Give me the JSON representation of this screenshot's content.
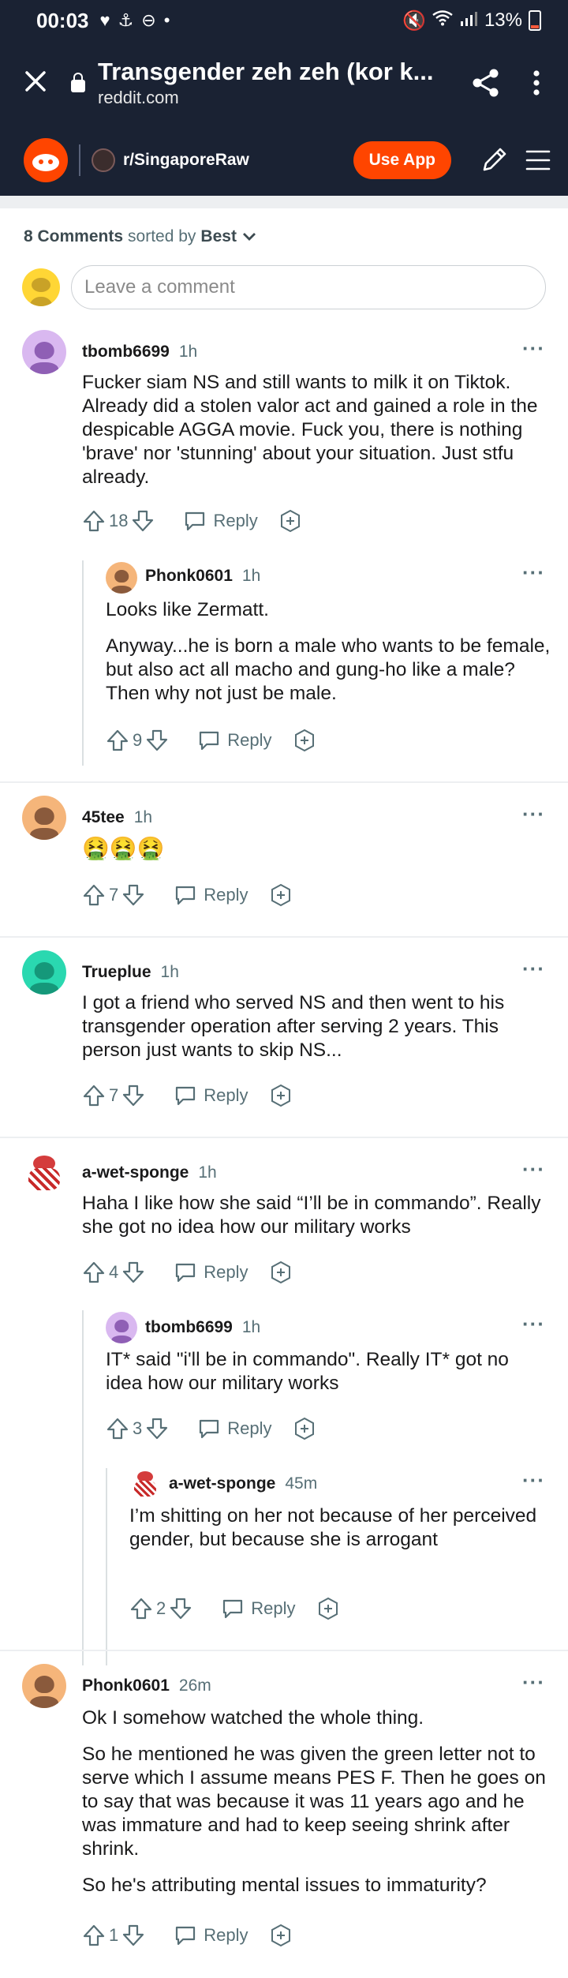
{
  "status_bar": {
    "time": "00:03",
    "battery": "13%"
  },
  "browser": {
    "page_title": "Transgender zeh zeh (kor k...",
    "domain": "reddit.com"
  },
  "reddit_header": {
    "subreddit": "r/SingaporeRaw",
    "use_app_label": "Use App"
  },
  "sort": {
    "count_label": "8 Comments",
    "sorted_by_label": "sorted by",
    "sort_value": "Best"
  },
  "comment_input": {
    "placeholder": "Leave a comment"
  },
  "colors": {
    "accent": "#ff4500",
    "header_bg": "#1a2233"
  },
  "comments": [
    {
      "author": "tbomb6699",
      "age": "1h",
      "paragraphs": [
        "Fucker siam NS and still wants to milk it on Tiktok. Already did a stolen valor act and gained a role in the despicable AGGA movie. Fuck you, there is nothing 'brave' nor 'stunning' about your situation. Just stfu already."
      ],
      "votes": "18",
      "reply_label": "Reply"
    },
    {
      "author": "Phonk0601",
      "age": "1h",
      "paragraphs": [
        "Looks like Zermatt.",
        "Anyway...he is born a male who wants to be female, but also act all macho and gung-ho like a male? Then why not just be male."
      ],
      "votes": "9",
      "reply_label": "Reply"
    },
    {
      "author": "45tee",
      "age": "1h",
      "paragraphs": [
        "🤮🤮🤮"
      ],
      "votes": "7",
      "reply_label": "Reply"
    },
    {
      "author": "Trueplue",
      "age": "1h",
      "paragraphs": [
        "I got a friend who served NS and then went to his transgender operation after serving 2 years. This person just wants to skip NS..."
      ],
      "votes": "7",
      "reply_label": "Reply"
    },
    {
      "author": "a-wet-sponge",
      "age": "1h",
      "paragraphs": [
        "Haha I like how she said “I’ll be in commando”. Really she got no idea how our military works"
      ],
      "votes": "4",
      "reply_label": "Reply"
    },
    {
      "author": "tbomb6699",
      "age": "1h",
      "paragraphs": [
        "IT* said \"i'll be in commando\". Really IT* got no idea how our military works"
      ],
      "votes": "3",
      "reply_label": "Reply"
    },
    {
      "author": "a-wet-sponge",
      "age": "45m",
      "paragraphs": [
        "I’m shitting on her not because of her perceived gender, but because she is arrogant"
      ],
      "votes": "2",
      "reply_label": "Reply"
    },
    {
      "author": "Phonk0601",
      "age": "26m",
      "paragraphs": [
        "Ok I somehow watched the whole thing.",
        "So he mentioned he was given the green letter not to serve which I assume means PES F. Then he goes on to say that was because it was 11 years ago and he was immature and had to keep seeing shrink after shrink.",
        "So he's attributing mental issues to immaturity?"
      ],
      "votes": "1",
      "reply_label": "Reply"
    }
  ]
}
